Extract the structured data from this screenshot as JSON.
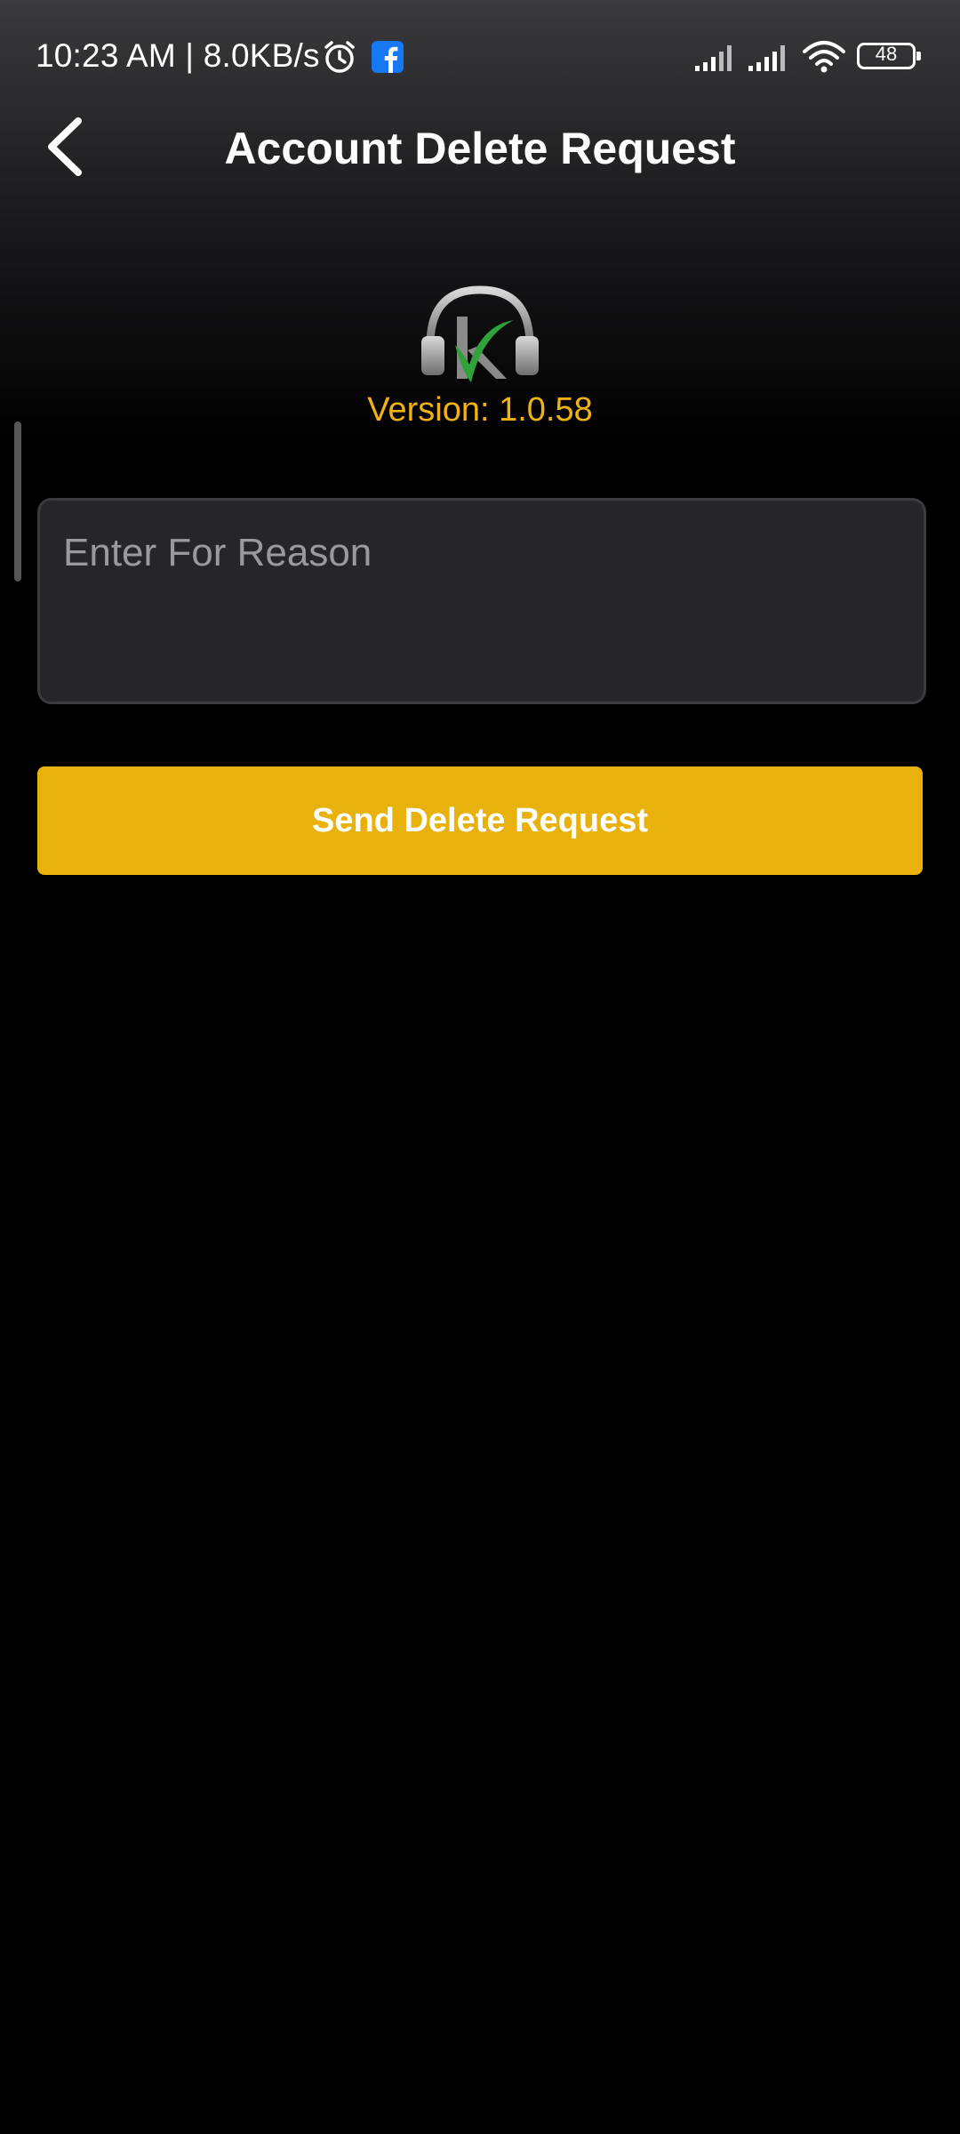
{
  "status_bar": {
    "time": "10:23 AM",
    "speed": "8.0KB/s",
    "separator": "|",
    "battery": "48",
    "icons": [
      "alarm-icon",
      "facebook-icon",
      "signal-icon",
      "signal-icon",
      "wifi-icon",
      "battery-icon"
    ]
  },
  "header": {
    "title": "Account Delete Request",
    "back_icon": "chevron-left-icon"
  },
  "app": {
    "version": "Version: 1.0.58",
    "logo_icon": "headphones-logo-icon"
  },
  "form": {
    "reason_placeholder": "Enter For Reason",
    "reason_value": "",
    "submit_label": "Send Delete Request"
  },
  "colors": {
    "accent": "#e8b10c",
    "version_text": "#f0b214",
    "input_bg": "#262628",
    "background": "#000000"
  }
}
